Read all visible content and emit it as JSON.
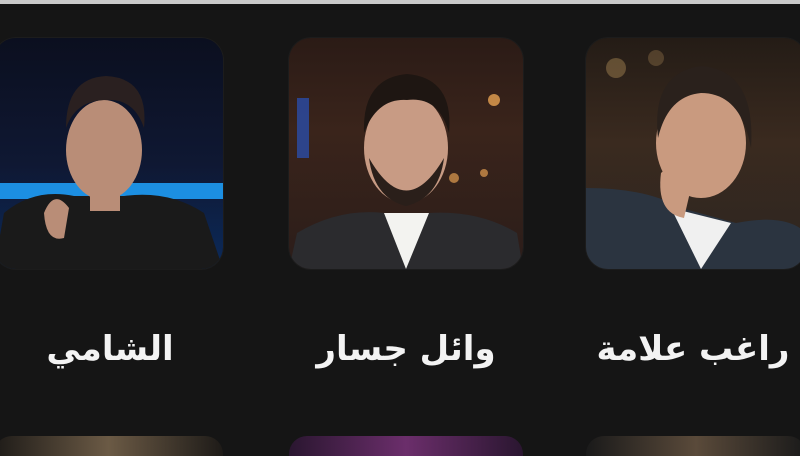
{
  "artists": [
    {
      "name": "الشامي"
    },
    {
      "name": "وائل جسار"
    },
    {
      "name": "راغب علامة"
    }
  ],
  "colors": {
    "background": "#151515",
    "text": "#f3f3f3"
  }
}
